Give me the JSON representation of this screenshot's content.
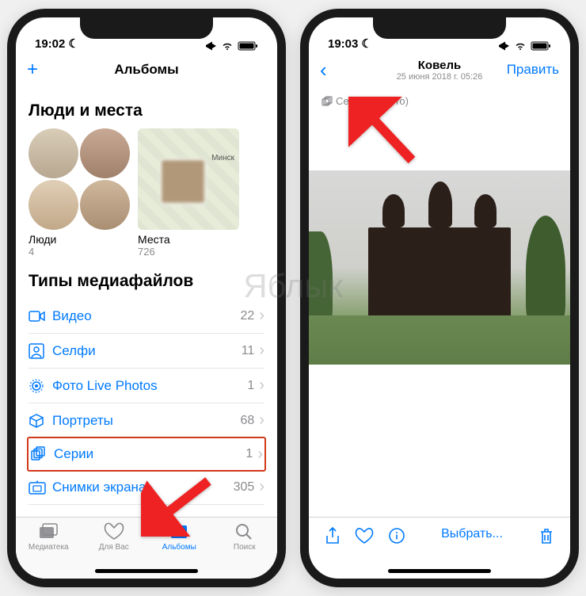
{
  "watermark": "Яблык",
  "phone1": {
    "status": {
      "time": "19:02",
      "moon": "☾"
    },
    "nav": {
      "add": "+",
      "title": "Альбомы"
    },
    "sections": {
      "people_places": "Люди и места",
      "media_types": "Типы медиафайлов"
    },
    "tiles": {
      "people": {
        "label": "Люди",
        "count": "4"
      },
      "places": {
        "label": "Места",
        "count": "726",
        "city": "Минск"
      }
    },
    "media": [
      {
        "icon": "video",
        "label": "Видео",
        "count": "22"
      },
      {
        "icon": "selfie",
        "label": "Селфи",
        "count": "11"
      },
      {
        "icon": "live",
        "label": "Фото Live Photos",
        "count": "1"
      },
      {
        "icon": "portrait",
        "label": "Портреты",
        "count": "68"
      },
      {
        "icon": "burst",
        "label": "Серии",
        "count": "1",
        "highlighted": true
      },
      {
        "icon": "screenshot",
        "label": "Снимки экрана",
        "count": "305"
      }
    ],
    "tabs": [
      {
        "label": "Медиатека"
      },
      {
        "label": "Для Вас"
      },
      {
        "label": "Альбомы",
        "active": true
      },
      {
        "label": "Поиск"
      }
    ]
  },
  "phone2": {
    "status": {
      "time": "19:03",
      "moon": "☾"
    },
    "nav": {
      "title": "Ковель",
      "subtitle": "25 июня 2018 г. 05:26",
      "edit": "Править"
    },
    "burst": "Серия (2 фото)",
    "toolbar": {
      "select": "Выбрать..."
    }
  }
}
